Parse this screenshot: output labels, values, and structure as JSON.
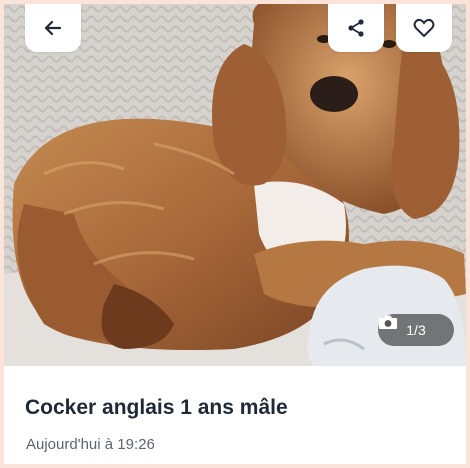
{
  "listing": {
    "title": "Cocker anglais 1 ans mâle",
    "date": "Aujourd'hui à 19:26"
  },
  "gallery": {
    "counter": "1/3"
  },
  "icons": {
    "back": "arrow-left-icon",
    "share": "share-icon",
    "favorite": "heart-icon",
    "camera": "camera-icon"
  },
  "colors": {
    "page_background": "#fbe3da",
    "title_text": "#1f2a36",
    "counter_background": "#464646"
  }
}
